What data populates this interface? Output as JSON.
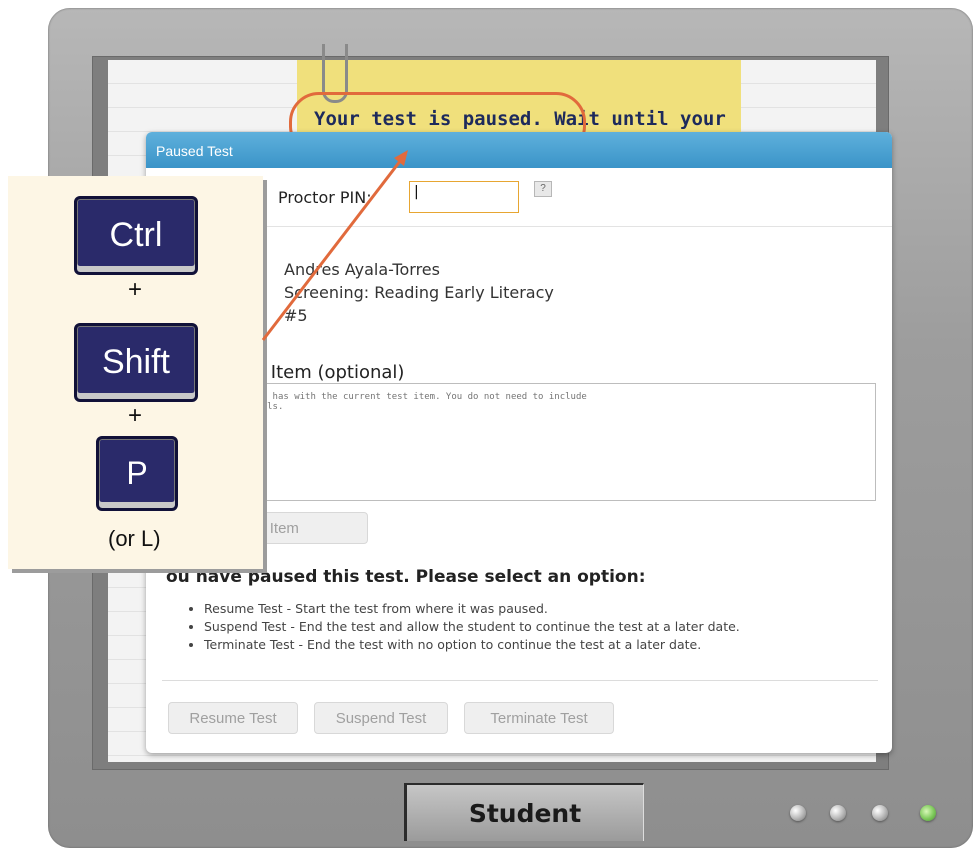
{
  "screen": {
    "notice_text": "Your test is paused. Wait until your",
    "student_label": "Student"
  },
  "dialog": {
    "title": "Paused Test",
    "pin_label": "Proctor PIN:",
    "pin_value": "|",
    "help_label": "?",
    "student_name": "Andres Ayala-Torres",
    "test_name": "Screening: Reading Early Literacy",
    "test_number": "#5",
    "problem_label": "blem Item (optional)",
    "problem_placeholder": "ssues the student has with the current test item. You do not need to include\nent-related details.",
    "submit_label": "blem Item",
    "options_heading": "ou have paused this test. Please select an option:",
    "options": [
      "Resume Test - Start the test from where it was paused.",
      "Suspend Test - End the test and allow the student to continue the test at a later date.",
      "Terminate Test - End the test with no option to continue the test at a later date."
    ],
    "resume_label": "Resume Test",
    "suspend_label": "Suspend Test",
    "terminate_label": "Terminate Test"
  },
  "shortcut": {
    "key1": "Ctrl",
    "plus1": "+",
    "key2": "Shift",
    "plus2": "+",
    "key3": "P",
    "alt": "(or L)"
  },
  "colors": {
    "title_bar": "#3b94c8",
    "highlight": "#e16a3c",
    "key": "#2a2a6a",
    "sticky_note": "#f0e07c"
  }
}
